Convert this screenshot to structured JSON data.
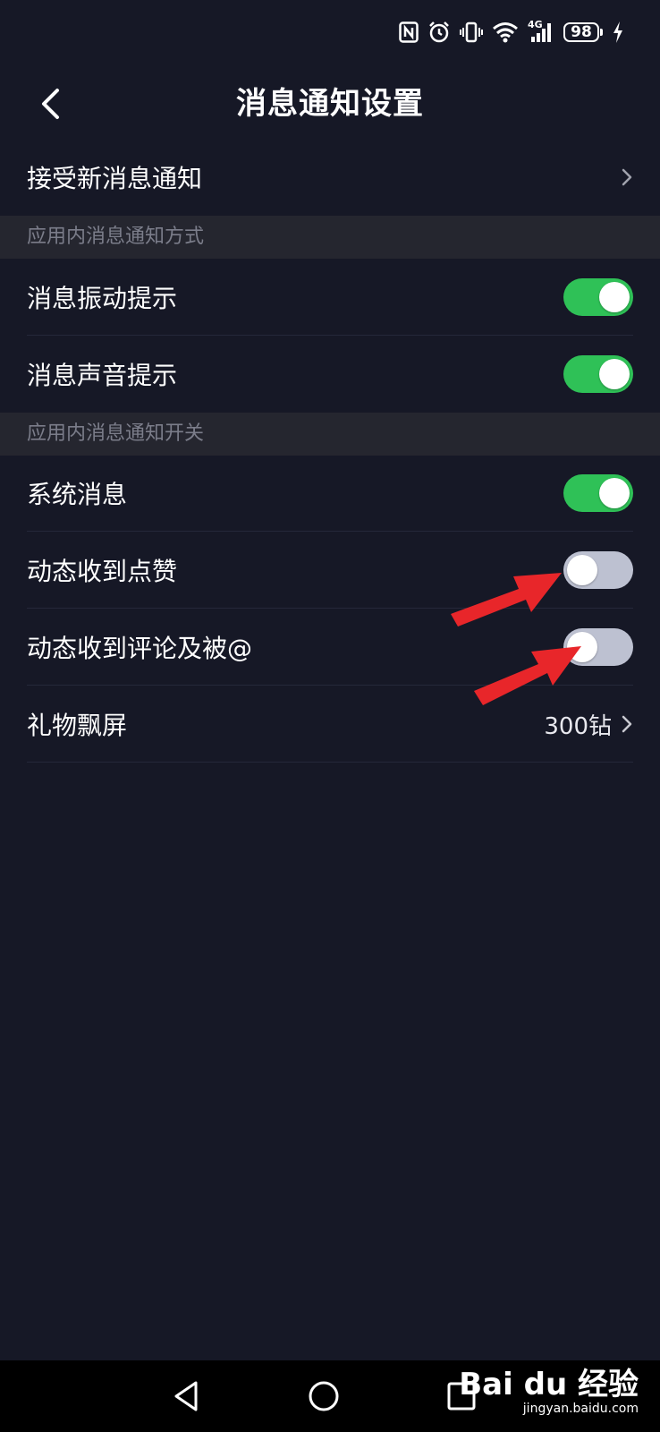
{
  "status_bar": {
    "icons": [
      "nfc-icon",
      "alarm-icon",
      "vibrate-icon",
      "wifi-icon",
      "signal-4g-icon"
    ],
    "network_label": "4G",
    "battery_level": "98",
    "charging": true
  },
  "header": {
    "title": "消息通知设置",
    "back_icon": "chevron-left-icon"
  },
  "rows_top": {
    "accept_new": {
      "label": "接受新消息通知"
    }
  },
  "section_method": {
    "title": "应用内消息通知方式",
    "vibrate": {
      "label": "消息振动提示",
      "on": true
    },
    "sound": {
      "label": "消息声音提示",
      "on": true
    }
  },
  "section_switch": {
    "title": "应用内消息通知开关",
    "system": {
      "label": "系统消息",
      "on": true
    },
    "likes": {
      "label": "动态收到点赞",
      "on": false
    },
    "comments": {
      "label": "动态收到评论及被@",
      "on": false
    },
    "gift": {
      "label": "礼物飘屏",
      "value": "300钻"
    }
  },
  "colors": {
    "background": "#161826",
    "section_bg": "#25262f",
    "toggle_on": "#2fc157",
    "toggle_off": "#bdc1d1",
    "annotation_arrow": "#e8262a"
  },
  "watermark": {
    "logo": "Bai du 经验",
    "url": "jingyan.baidu.com"
  }
}
